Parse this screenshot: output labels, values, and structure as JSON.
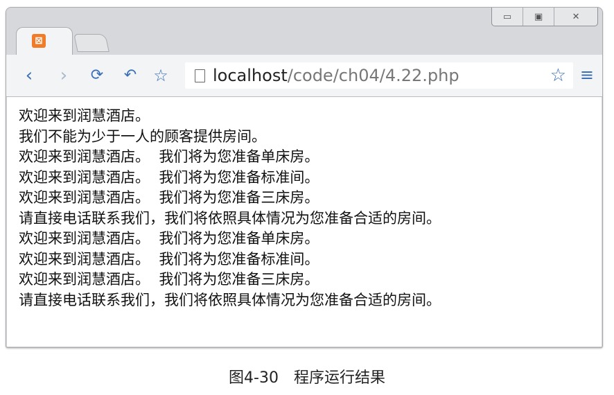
{
  "browser": {
    "address_host": "localhost",
    "address_path": "/code/ch04/4.22.php",
    "icons": [
      "xampp-favicon",
      "back-icon",
      "forward-icon",
      "reload-icon",
      "undo-icon",
      "star-icon",
      "page-icon",
      "bookmark-star-icon",
      "menu-icon",
      "minimize-icon",
      "maximize-icon",
      "close-icon"
    ]
  },
  "page": {
    "lines": [
      "欢迎来到润慧酒店。",
      "我们不能为少于一人的顾客提供房间。",
      "欢迎来到润慧酒店。  我们将为您准备单床房。",
      "欢迎来到润慧酒店。  我们将为您准备标准间。",
      "欢迎来到润慧酒店。  我们将为您准备三床房。",
      "请直接电话联系我们，我们将依照具体情况为您准备合适的房间。",
      "欢迎来到润慧酒店。  我们将为您准备单床房。",
      "欢迎来到润慧酒店。  我们将为您准备标准间。",
      "欢迎来到润慧酒店。  我们将为您准备三床房。",
      "请直接电话联系我们，我们将依照具体情况为您准备合适的房间。"
    ]
  },
  "caption": "图4-30　程序运行结果"
}
